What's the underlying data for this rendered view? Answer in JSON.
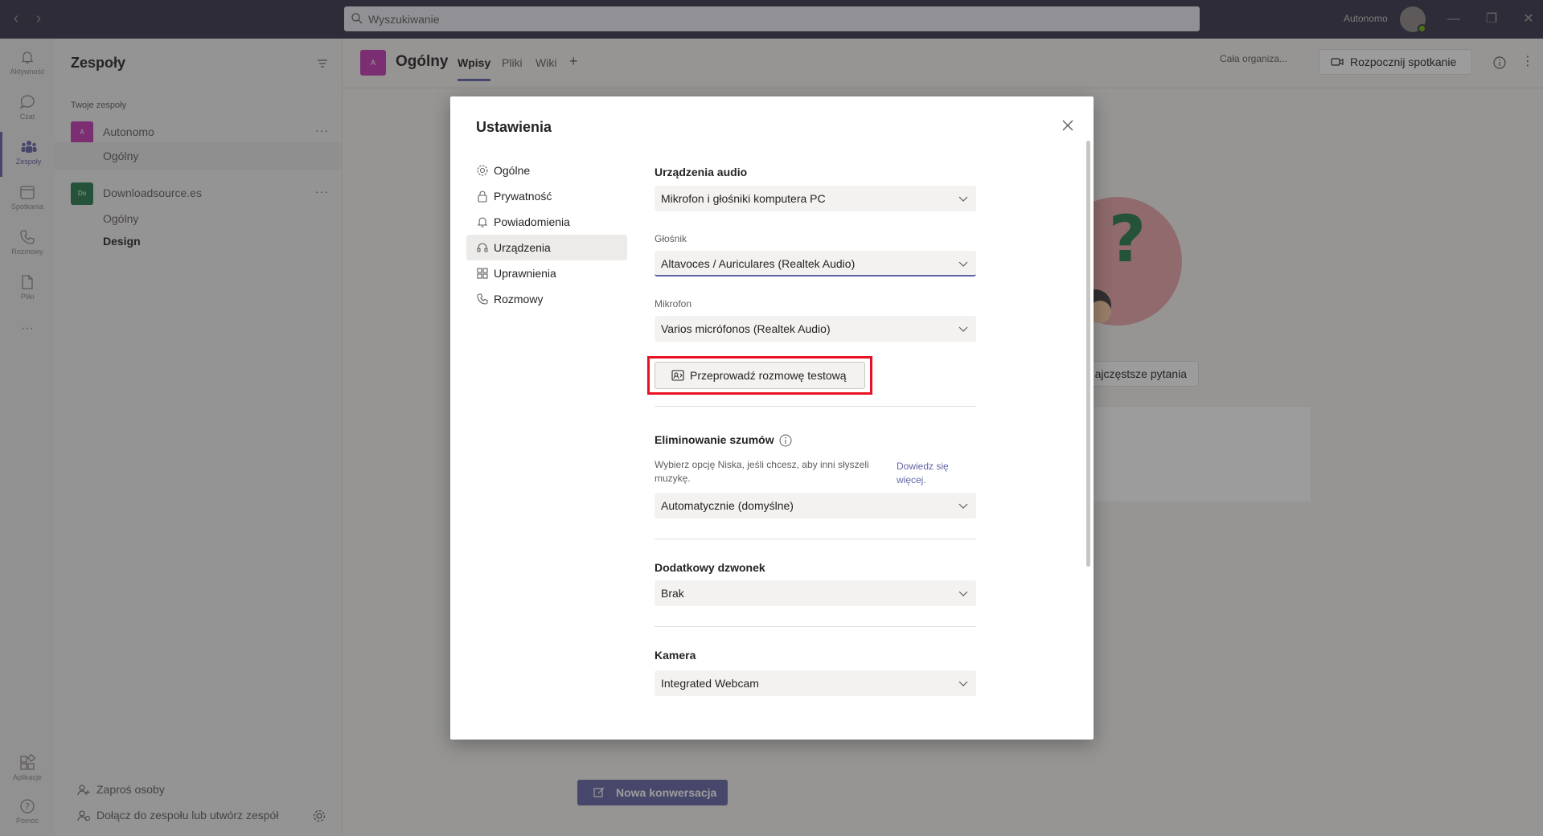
{
  "titlebar": {
    "search_placeholder": "Wyszukiwanie",
    "account_name": "Autonomo",
    "icons": [
      "back-icon",
      "forward-icon",
      "search-icon",
      "minimize-icon",
      "restore-icon",
      "close-icon"
    ]
  },
  "rail": {
    "items": [
      {
        "label": "Aktywność",
        "icon": "bell-icon"
      },
      {
        "label": "Czat",
        "icon": "chat-icon"
      },
      {
        "label": "Zespoły",
        "icon": "teams-icon"
      },
      {
        "label": "Spotkania",
        "icon": "calendar-icon"
      },
      {
        "label": "Rozmowy",
        "icon": "phone-icon"
      },
      {
        "label": "Pliki",
        "icon": "file-icon"
      },
      {
        "label": "Aplikacje",
        "icon": "apps-icon"
      },
      {
        "label": "Pomoc",
        "icon": "help-icon"
      }
    ],
    "more": "···"
  },
  "teams_panel": {
    "title": "Zespoły",
    "section": "Twoje zespoły",
    "teams": [
      {
        "initials": "A",
        "name": "Autonomo",
        "color": "#c239b3",
        "channels": [
          "Ogólny"
        ]
      },
      {
        "initials": "Do",
        "name": "Downloadsource.es",
        "color": "#237b4b",
        "channels": [
          "Ogólny",
          "Design"
        ]
      }
    ],
    "more_glyph": "···",
    "invite": "Zaproś osoby",
    "join_create": "Dołącz do zespołu lub utwórz zespół"
  },
  "channel_header": {
    "tile": "A",
    "name": "Ogólny",
    "tabs": [
      "Wpisy",
      "Pliki",
      "Wiki"
    ],
    "add_tab": "+",
    "org": "Cała organiza...",
    "start_meeting": "Rozpocznij spotkanie"
  },
  "background": {
    "faq_button": "ajczęstsze pytania",
    "new_conversation": "Nowa konwersacja"
  },
  "dialog": {
    "title": "Ustawienia",
    "nav": [
      {
        "label": "Ogólne",
        "icon": "gear-icon"
      },
      {
        "label": "Prywatność",
        "icon": "lock-icon"
      },
      {
        "label": "Powiadomienia",
        "icon": "bell-icon"
      },
      {
        "label": "Urządzenia",
        "icon": "headset-icon",
        "active": true
      },
      {
        "label": "Uprawnienia",
        "icon": "grid-icon"
      },
      {
        "label": "Rozmowy",
        "icon": "phone-icon"
      }
    ],
    "audio": {
      "title": "Urządzenia audio",
      "device": "Mikrofon i głośniki komputera PC",
      "speaker_label": "Głośnik",
      "speaker": "Altavoces / Auriculares (Realtek Audio)",
      "mic_label": "Mikrofon",
      "mic": "Varios micrófonos (Realtek Audio)",
      "test_call": "Przeprowadź rozmowę testową"
    },
    "noise": {
      "title": "Eliminowanie szumów",
      "desc": "Wybierz opcję Niska, jeśli chcesz, aby inni słyszeli muzykę.",
      "link": "Dowiedz się więcej.",
      "value": "Automatycznie (domyślne)"
    },
    "ringer": {
      "title": "Dodatkowy dzwonek",
      "value": "Brak"
    },
    "camera": {
      "title": "Kamera",
      "value": "Integrated Webcam"
    }
  },
  "colors": {
    "accent": "#6264a7",
    "titlebar": "#33344a",
    "highlight": "#e81123"
  }
}
